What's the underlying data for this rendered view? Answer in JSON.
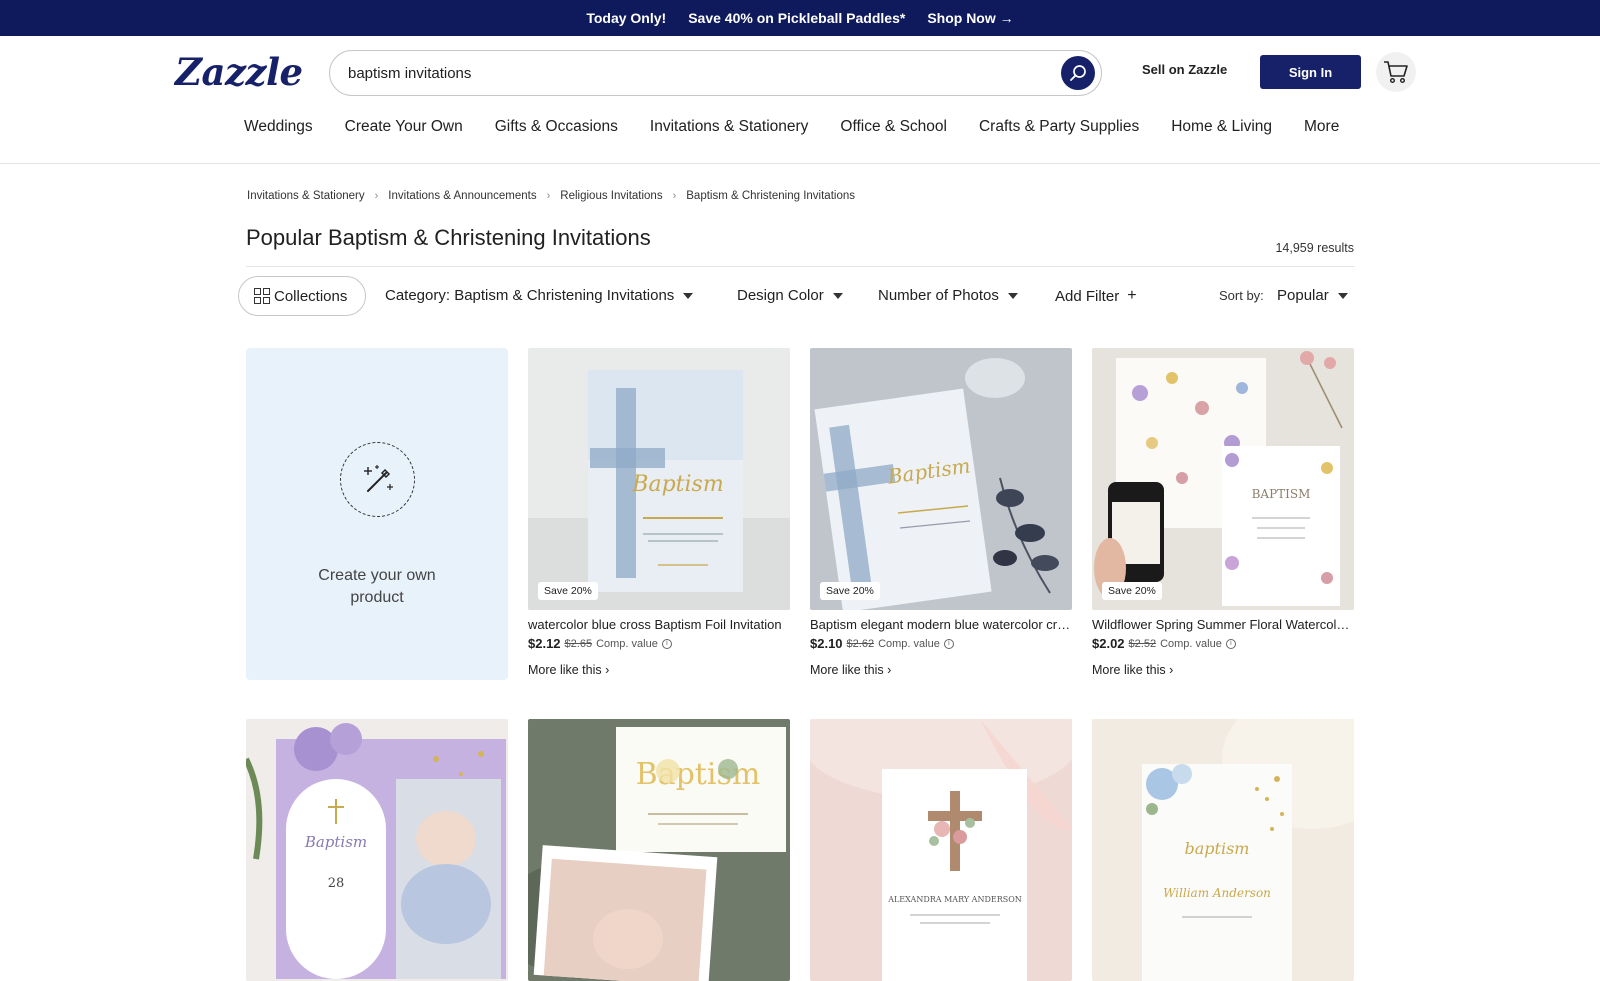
{
  "promo": {
    "today": "Today Only!",
    "offer": "Save 40% on Pickleball Paddles*",
    "cta": "Shop Now →"
  },
  "header": {
    "logo": "Zazzle",
    "search_value": "baptism invitations",
    "sell": "Sell on Zazzle",
    "signin": "Sign In"
  },
  "nav": [
    "Weddings",
    "Create Your Own",
    "Gifts & Occasions",
    "Invitations & Stationery",
    "Office & School",
    "Crafts & Party Supplies",
    "Home & Living",
    "More"
  ],
  "breadcrumbs": [
    "Invitations & Stationery",
    "Invitations & Announcements",
    "Religious Invitations",
    "Baptism & Christening Invitations"
  ],
  "page": {
    "title": "Popular Baptism & Christening Invitations",
    "results": "14,959 results"
  },
  "filters": {
    "collections": "Collections",
    "category": "Category: Baptism & Christening Invitations",
    "color": "Design Color",
    "photos": "Number of Photos",
    "add": "Add Filter",
    "sort_label": "Sort by:",
    "sort_value": "Popular"
  },
  "create_card": {
    "label": "Create your own product"
  },
  "products": [
    {
      "title": "watercolor blue cross Baptism Foil Invitation",
      "price": "$2.12",
      "was": "$2.65",
      "comp": "Comp. value",
      "badge": "Save 20%",
      "more": "More like this"
    },
    {
      "title": "Baptism elegant modern blue watercolor cross",
      "price": "$2.10",
      "was": "$2.62",
      "comp": "Comp. value",
      "badge": "Save 20%",
      "more": "More like this"
    },
    {
      "title": "Wildflower Spring Summer Floral Watercolor Baptism",
      "price": "$2.02",
      "was": "$2.52",
      "comp": "Comp. value",
      "badge": "Save 20%",
      "more": "More like this"
    }
  ],
  "row2_icons": [
    "purple-floral-baptism-photo-card",
    "gold-baptism-photo-card",
    "pink-floral-cross-card",
    "blue-floral-baptism-card"
  ],
  "colors": {
    "brand": "#16216a",
    "promo_bg": "#0e1a5c",
    "create_bg": "#e8f2fb"
  }
}
